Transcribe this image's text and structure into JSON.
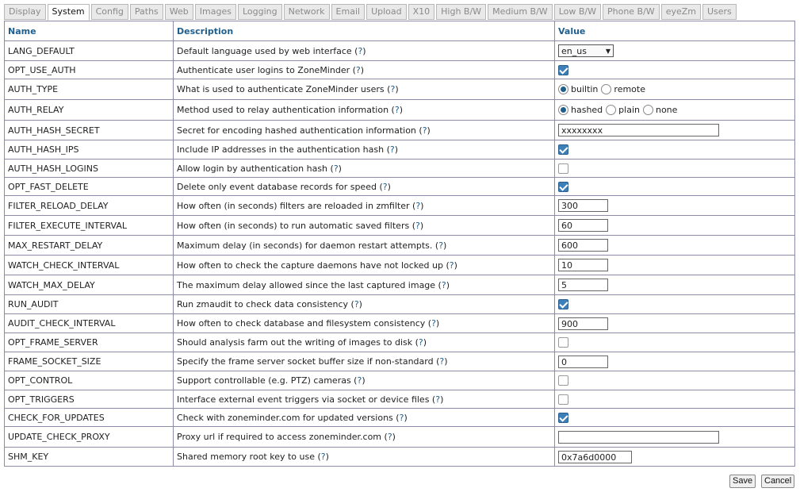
{
  "tabs": [
    "Display",
    "System",
    "Config",
    "Paths",
    "Web",
    "Images",
    "Logging",
    "Network",
    "Email",
    "Upload",
    "X10",
    "High B/W",
    "Medium B/W",
    "Low B/W",
    "Phone B/W",
    "eyeZm",
    "Users"
  ],
  "active_tab": "System",
  "headers": {
    "name": "Name",
    "description": "Description",
    "value": "Value"
  },
  "help_mark": "?",
  "rows": [
    {
      "name": "LANG_DEFAULT",
      "desc": "Default language used by web interface",
      "type": "select",
      "value": "en_us",
      "h": 25
    },
    {
      "name": "OPT_USE_AUTH",
      "desc": "Authenticate user logins to ZoneMinder",
      "type": "checkbox",
      "checked": true,
      "h": 23
    },
    {
      "name": "AUTH_TYPE",
      "desc": "What is used to authenticate ZoneMinder users",
      "type": "radio",
      "options": [
        "builtin",
        "remote"
      ],
      "selected": 0,
      "h": 26
    },
    {
      "name": "AUTH_RELAY",
      "desc": "Method used to relay authentication information",
      "type": "radio",
      "options": [
        "hashed",
        "plain",
        "none"
      ],
      "selected": 0,
      "h": 26
    },
    {
      "name": "AUTH_HASH_SECRET",
      "desc": "Secret for encoding hashed authentication information",
      "type": "text",
      "value": "xxxxxxxx",
      "w": 203,
      "h": 25
    },
    {
      "name": "AUTH_HASH_IPS",
      "desc": "Include IP addresses in the authentication hash",
      "type": "checkbox",
      "checked": true,
      "h": 24
    },
    {
      "name": "AUTH_HASH_LOGINS",
      "desc": "Allow login by authentication hash",
      "type": "checkbox",
      "checked": false,
      "h": 23
    },
    {
      "name": "OPT_FAST_DELETE",
      "desc": "Delete only event database records for speed",
      "type": "checkbox",
      "checked": true,
      "h": 23
    },
    {
      "name": "FILTER_RELOAD_DELAY",
      "desc": "How often (in seconds) filters are reloaded in zmfilter",
      "type": "text",
      "value": "300",
      "w": 63,
      "h": 25
    },
    {
      "name": "FILTER_EXECUTE_INTERVAL",
      "desc": "How often (in seconds) to run automatic saved filters",
      "type": "text",
      "value": "60",
      "w": 63,
      "h": 25
    },
    {
      "name": "MAX_RESTART_DELAY",
      "desc": "Maximum delay (in seconds) for daemon restart attempts.",
      "type": "text",
      "value": "600",
      "w": 63,
      "h": 25
    },
    {
      "name": "WATCH_CHECK_INTERVAL",
      "desc": "How often to check the capture daemons have not locked up",
      "type": "text",
      "value": "10",
      "w": 63,
      "h": 25
    },
    {
      "name": "WATCH_MAX_DELAY",
      "desc": "The maximum delay allowed since the last captured image",
      "type": "text",
      "value": "5",
      "w": 63,
      "h": 25
    },
    {
      "name": "RUN_AUDIT",
      "desc": "Run zmaudit to check data consistency",
      "type": "checkbox",
      "checked": true,
      "h": 24
    },
    {
      "name": "AUDIT_CHECK_INTERVAL",
      "desc": "How often to check database and filesystem consistency",
      "type": "text",
      "value": "900",
      "w": 63,
      "h": 24
    },
    {
      "name": "OPT_FRAME_SERVER",
      "desc": "Should analysis farm out the writing of images to disk",
      "type": "checkbox",
      "checked": false,
      "h": 24
    },
    {
      "name": "FRAME_SOCKET_SIZE",
      "desc": "Specify the frame server socket buffer size if non-standard",
      "type": "text",
      "value": "0",
      "w": 63,
      "h": 24
    },
    {
      "name": "OPT_CONTROL",
      "desc": "Support controllable (e.g. PTZ) cameras",
      "type": "checkbox",
      "checked": false,
      "h": 24
    },
    {
      "name": "OPT_TRIGGERS",
      "desc": "Interface external event triggers via socket or device files",
      "type": "checkbox",
      "checked": false,
      "h": 23
    },
    {
      "name": "CHECK_FOR_UPDATES",
      "desc": "Check with zoneminder.com for updated versions",
      "type": "checkbox",
      "checked": true,
      "h": 23
    },
    {
      "name": "UPDATE_CHECK_PROXY",
      "desc": "Proxy url if required to access zoneminder.com",
      "type": "text",
      "value": "",
      "w": 203,
      "h": 26
    },
    {
      "name": "SHM_KEY",
      "desc": "Shared memory root key to use",
      "type": "text",
      "value": "0x7a6d0000",
      "w": 93,
      "h": 24
    }
  ],
  "buttons": {
    "save": "Save",
    "cancel": "Cancel"
  },
  "colors": {
    "header": "#1e5f8e",
    "check": "#3d7fb8",
    "border": "#8c8ca8"
  }
}
